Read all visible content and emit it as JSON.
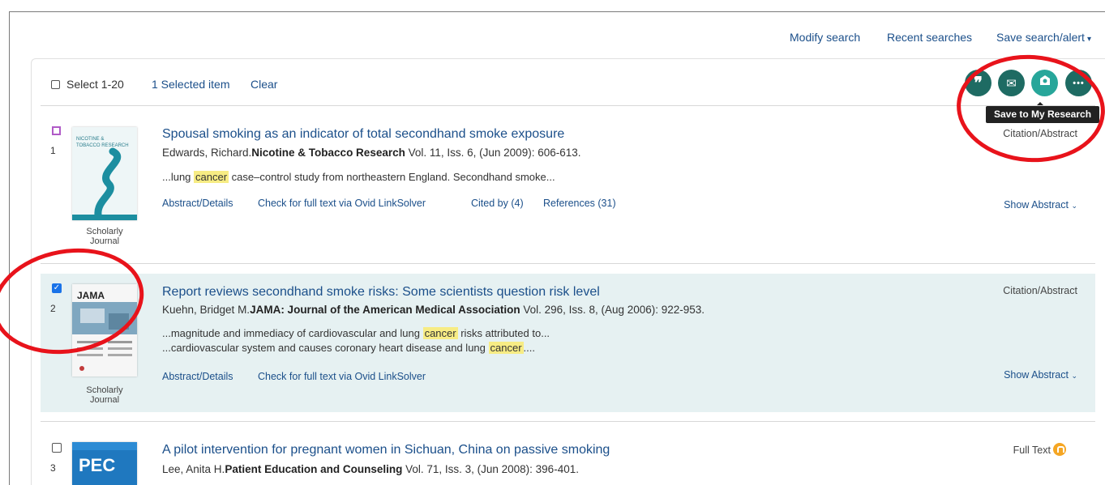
{
  "top_links": {
    "modify": "Modify search",
    "recent": "Recent searches",
    "save_alert": "Save search/alert",
    "save_alert_caret": "▾"
  },
  "selection_bar": {
    "select_label": "Select 1-20",
    "selected_count": "1 Selected item",
    "clear": "Clear"
  },
  "toolbar": {
    "buttons": [
      {
        "icon": "cite-quote-icon",
        "glyph": "❞"
      },
      {
        "icon": "email-icon",
        "glyph": "✉"
      },
      {
        "icon": "save-to-my-research-icon",
        "glyph": ""
      },
      {
        "icon": "more-icon",
        "glyph": "•••"
      }
    ],
    "tooltip": "Save to My Research"
  },
  "results": [
    {
      "num": "1",
      "checked": false,
      "title": "Spousal smoking as an indicator of total secondhand smoke exposure",
      "author": "Edwards, Richard.",
      "journal": "Nicotine & Tobacco Research",
      "details": " Vol. 11, Iss. 6,  (Jun 2009): 606-613.",
      "snippets": [
        {
          "pre": "...lung ",
          "hl": "cancer",
          "post": " case–control study from northeastern England. Secondhand smoke..."
        }
      ],
      "actions": [
        "Abstract/Details",
        "Check for full text via Ovid LinkSolver",
        "Cited by (4)",
        "References (31)"
      ],
      "type_label": "Citation/Abstract",
      "show_abstract": "Show Abstract",
      "doc_type": "Scholarly Journal",
      "cover_title": "NICOTINE & TOBACCO RESEARCH"
    },
    {
      "num": "2",
      "checked": true,
      "title": "Report reviews secondhand smoke risks: Some scientists question risk level",
      "author": "Kuehn, Bridget M.",
      "journal": "JAMA: Journal of the American Medical Association",
      "details": " Vol. 296, Iss. 8,  (Aug 2006): 922-953.",
      "snippets": [
        {
          "pre": "...magnitude and immediacy of cardiovascular and lung ",
          "hl": "cancer",
          "post": " risks attributed to..."
        },
        {
          "pre": "...cardiovascular system and causes coronary heart disease and lung ",
          "hl": "cancer",
          "post": "...."
        }
      ],
      "actions": [
        "Abstract/Details",
        "Check for full text via Ovid LinkSolver"
      ],
      "type_label": "Citation/Abstract",
      "show_abstract": "Show Abstract",
      "doc_type": "Scholarly Journal",
      "cover_title": "JAMA"
    },
    {
      "num": "3",
      "checked": false,
      "title": "A pilot intervention for pregnant women in Sichuan, China on passive smoking",
      "author": "Lee, Anita H.",
      "journal": "Patient Education and Counseling",
      "details": " Vol. 71, Iss. 3,  (Jun 2008): 396-401.",
      "type_label": "Full Text",
      "cover_title": "PEC"
    }
  ],
  "colors": {
    "link": "#1b4f8a",
    "toolbar_button": "#1e6b63",
    "selected_row": "#e6f1f2",
    "highlight": "#f7ec84",
    "annotation": "#e8131b"
  }
}
